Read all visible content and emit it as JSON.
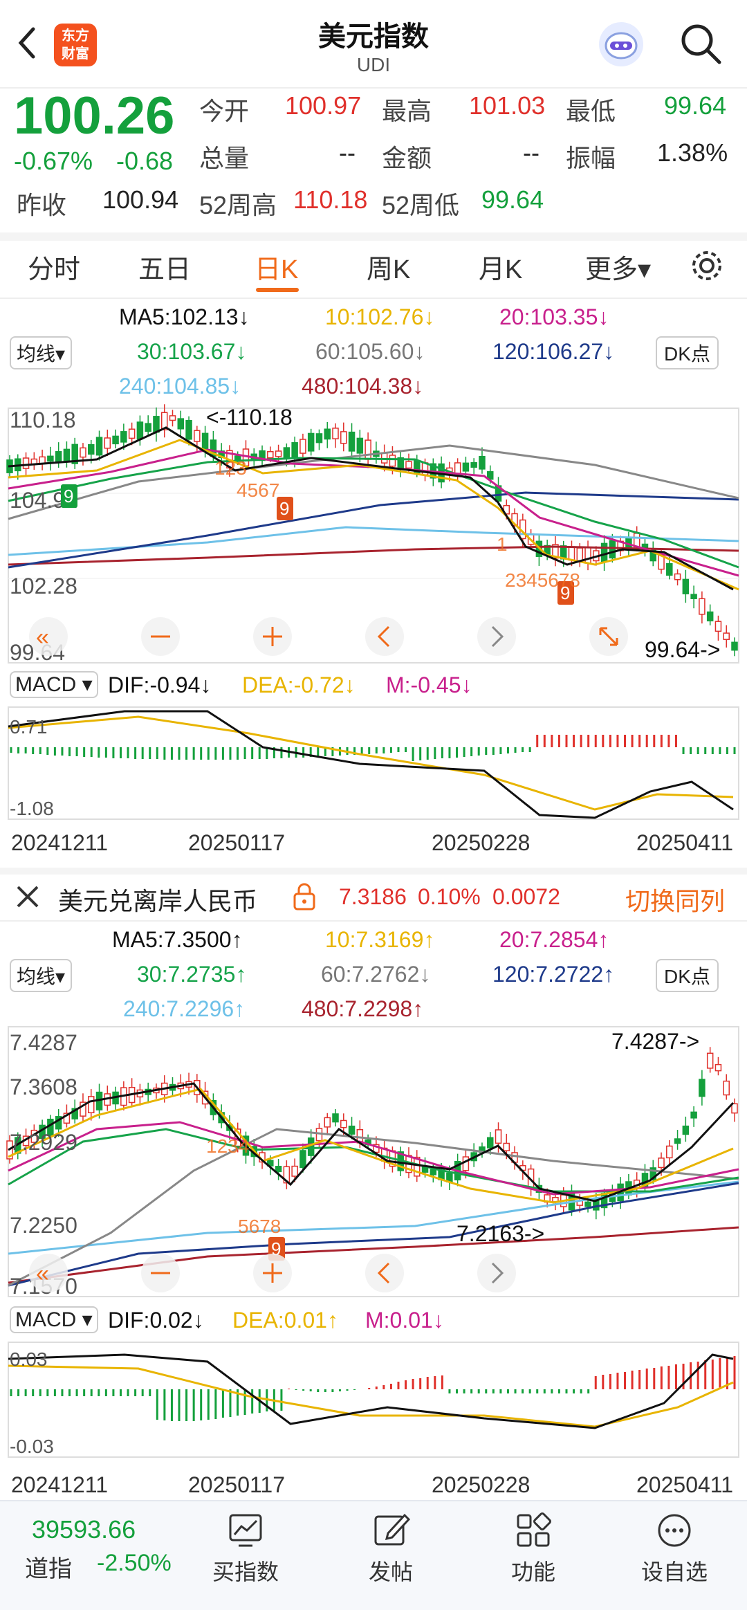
{
  "header": {
    "title": "美元指数",
    "subtitle": "UDI",
    "logo": "东方\n财富",
    "back_icon": "chevron-left-icon",
    "search_icon": "search-icon"
  },
  "quote": {
    "price": "100.26",
    "change_pct": "-0.67%",
    "change": "-0.68",
    "open_label": "今开",
    "open": "100.97",
    "high_label": "最高",
    "high": "101.03",
    "low_label": "最低",
    "low": "99.64",
    "vol_label": "总量",
    "vol": "--",
    "amount_label": "金额",
    "amount": "--",
    "amp_label": "振幅",
    "amp": "1.38%",
    "prev_label": "昨收",
    "prev": "100.94",
    "w52h_label": "52周高",
    "w52h": "110.18",
    "w52l_label": "52周低",
    "w52l": "99.64"
  },
  "tabs": {
    "items": [
      "分时",
      "五日",
      "日K",
      "周K",
      "月K",
      "更多▾"
    ],
    "active": 2
  },
  "chart1": {
    "ma_toggle": "均线▾",
    "dk_btn": "DK点",
    "ma": {
      "ma5": "MA5:102.13↓",
      "ma10": "10:102.76↓",
      "ma20": "20:103.35↓",
      "ma30": "30:103.67↓",
      "ma60": "60:105.60↓",
      "ma120": "120:106.27↓",
      "ma240": "240:104.85↓",
      "ma480": "480:104.38↓"
    },
    "ylabels": [
      "110.18",
      "104.91",
      "102.28",
      "99.64"
    ],
    "max_label": "<-110.18",
    "min_label": "99.64->",
    "macd": {
      "sel": "MACD ▾",
      "dif": "DIF:-0.94↓",
      "dea": "DEA:-0.72↓",
      "m": "M:-0.45↓",
      "y_top": "0.71",
      "y_bot": "-1.08"
    },
    "dates": [
      "20241211",
      "20250117",
      "20250228",
      "20250411"
    ]
  },
  "compare": {
    "close_icon": "close-icon",
    "name": "美元兑离岸人民币",
    "lock_icon": "lock-icon",
    "price": "7.3186",
    "pct": "0.10%",
    "chg": "0.0072",
    "switch": "切换同列"
  },
  "chart2": {
    "ma_toggle": "均线▾",
    "dk_btn": "DK点",
    "ma": {
      "ma5": "MA5:7.3500↑",
      "ma10": "10:7.3169↑",
      "ma20": "20:7.2854↑",
      "ma30": "30:7.2735↑",
      "ma60": "60:7.2762↓",
      "ma120": "120:7.2722↑",
      "ma240": "240:7.2296↑",
      "ma480": "480:7.2298↑"
    },
    "ylabels": [
      "7.4287",
      "7.3608",
      "7.2929",
      "7.2250",
      "7.1570"
    ],
    "max_label": "7.4287->",
    "min_label": "7.2163->",
    "macd": {
      "sel": "MACD ▾",
      "dif": "DIF:0.02↓",
      "dea": "DEA:0.01↑",
      "m": "M:0.01↓",
      "y_top": "0.03",
      "y_bot": "-0.03"
    },
    "dates": [
      "20241211",
      "20250117",
      "20250228",
      "20250411"
    ]
  },
  "bottom": {
    "index_value": "39593.66",
    "index_name": "道指",
    "index_pct": "-2.50%",
    "items": [
      {
        "label": "买指数",
        "icon": "chart-trend-icon"
      },
      {
        "label": "发帖",
        "icon": "edit-icon"
      },
      {
        "label": "功能",
        "icon": "grid-icon"
      },
      {
        "label": "设自选",
        "icon": "more-dots-icon"
      }
    ]
  },
  "colors": {
    "red": "#e0302b",
    "green": "#14a03c",
    "orange": "#f06a1a",
    "ma5": "#111111",
    "ma10": "#e8b400",
    "ma20": "#c8208c",
    "ma30": "#16a34a",
    "ma60": "#8a8a8a",
    "ma120": "#1e3a8a",
    "ma240": "#6ec1e8",
    "ma480": "#a8232e"
  }
}
